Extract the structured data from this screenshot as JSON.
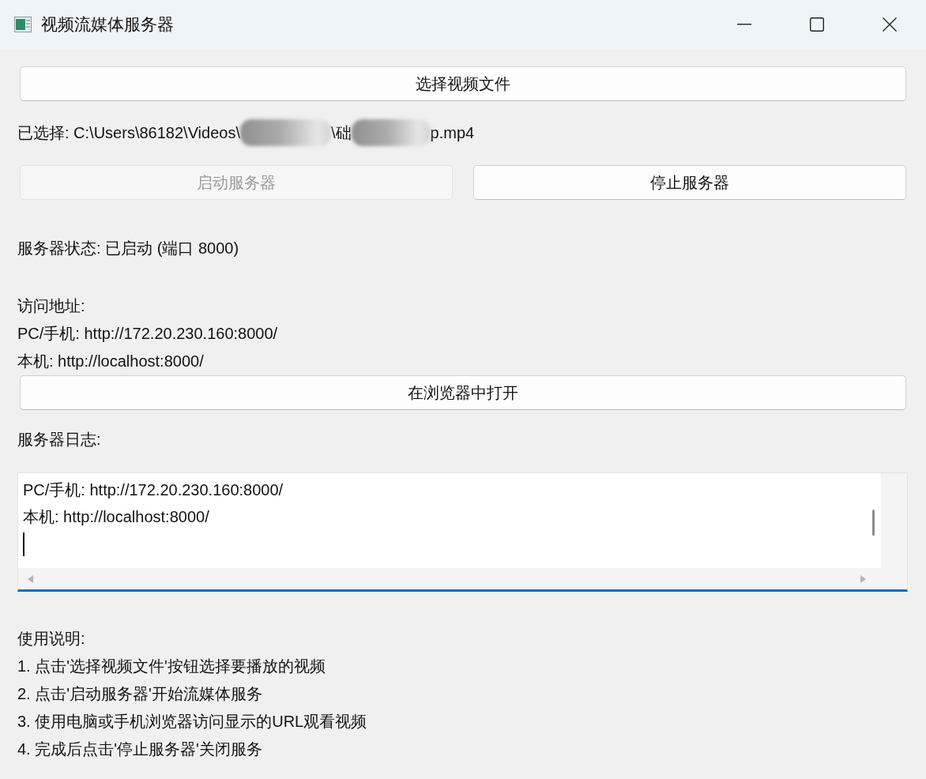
{
  "window": {
    "title": "视频流媒体服务器"
  },
  "select_button": {
    "label": "选择视频文件",
    "disabled": false
  },
  "selected_path": {
    "segments": [
      {
        "kind": "text",
        "text": "已选择: C:\\Users\\86182\\Videos\\"
      },
      {
        "kind": "redacted"
      },
      {
        "kind": "text",
        "text": "\\础"
      },
      {
        "kind": "redacted"
      },
      {
        "kind": "text",
        "text": "p.mp4"
      }
    ]
  },
  "server_buttons": [
    {
      "label": "启动服务器",
      "disabled": true
    },
    {
      "label": "停止服务器",
      "disabled": false
    }
  ],
  "status": "服务器状态: 已启动 (端口 8000)",
  "address": {
    "heading": "访问地址:",
    "lines": [
      "PC/手机: http://172.20.230.160:8000/",
      "本机: http://localhost:8000/"
    ]
  },
  "open_button": {
    "label": "在浏览器中打开",
    "disabled": false
  },
  "log": {
    "heading": "服务器日志:",
    "lines": [
      "PC/手机: http://172.20.230.160:8000/",
      "本机: http://localhost:8000/"
    ],
    "focused": true
  },
  "instructions": {
    "heading": "使用说明:",
    "lines": [
      "1. 点击'选择视频文件'按钮选择要播放的视频",
      "2. 点击'启动服务器'开始流媒体服务",
      "3. 使用电脑或手机浏览器访问显示的URL观看视频",
      "4. 完成后点击'停止服务器'关闭服务"
    ]
  }
}
